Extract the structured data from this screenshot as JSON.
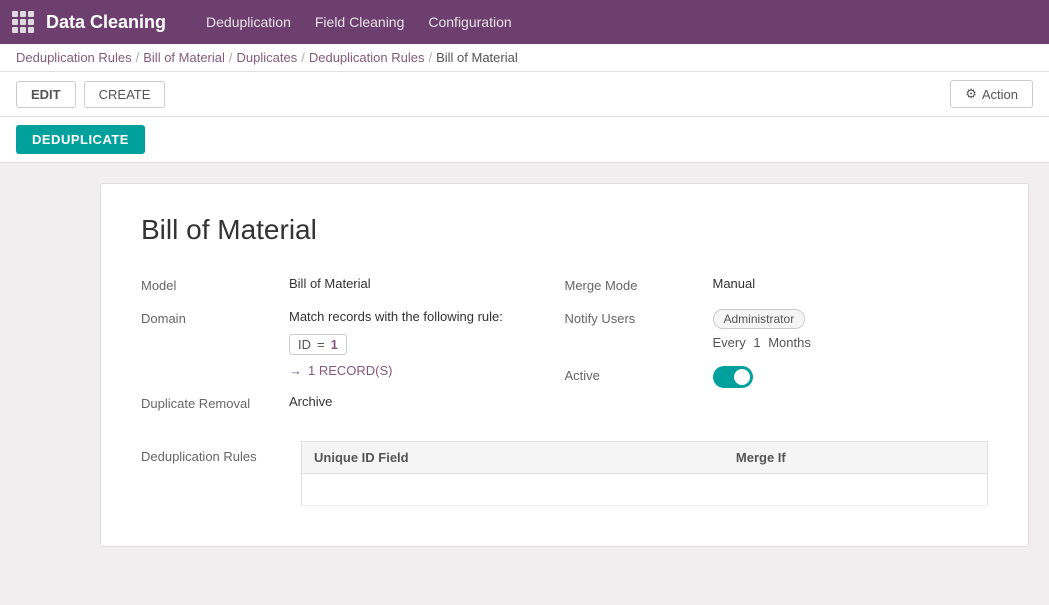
{
  "topbar": {
    "app_title": "Data Cleaning",
    "nav_items": [
      "Deduplication",
      "Field Cleaning",
      "Configuration"
    ]
  },
  "breadcrumb": {
    "items": [
      {
        "label": "Deduplication Rules",
        "link": true
      },
      {
        "label": "Bill of Material",
        "link": true
      },
      {
        "label": "Duplicates",
        "link": true
      },
      {
        "label": "Deduplication Rules",
        "link": true
      },
      {
        "label": "Bill of Material",
        "link": false
      }
    ]
  },
  "toolbar": {
    "edit_label": "EDIT",
    "create_label": "CREATE",
    "action_label": "Action"
  },
  "deduplicate_bar": {
    "button_label": "DEDUPLICATE"
  },
  "record": {
    "title": "Bill of Material",
    "model_label": "Model",
    "model_value": "Bill of Material",
    "domain_label": "Domain",
    "domain_text": "Match records with the following rule:",
    "domain_field": "ID",
    "domain_op": "=",
    "domain_val": "1",
    "records_link": "1 RECORD(S)",
    "duplicate_removal_label": "Duplicate Removal",
    "duplicate_removal_value": "Archive",
    "deduplication_rules_label": "Deduplication Rules",
    "merge_mode_label": "Merge Mode",
    "merge_mode_value": "Manual",
    "notify_users_label": "Notify Users",
    "notify_users_value": "Administrator",
    "notify_every": "Every",
    "notify_number": "1",
    "notify_unit": "Months",
    "active_label": "Active",
    "table_col1": "Unique ID Field",
    "table_col2": "Merge If"
  }
}
